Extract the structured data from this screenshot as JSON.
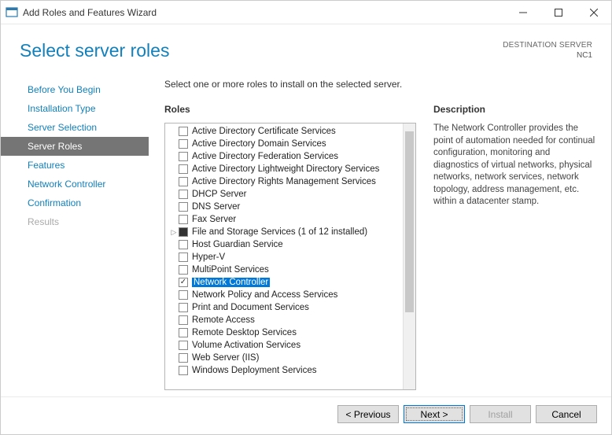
{
  "window": {
    "title": "Add Roles and Features Wizard"
  },
  "header": {
    "page_title": "Select server roles",
    "dest_label": "DESTINATION SERVER",
    "dest_server": "NC1"
  },
  "nav": {
    "items": [
      {
        "label": "Before You Begin",
        "state": "normal"
      },
      {
        "label": "Installation Type",
        "state": "normal"
      },
      {
        "label": "Server Selection",
        "state": "normal"
      },
      {
        "label": "Server Roles",
        "state": "active"
      },
      {
        "label": "Features",
        "state": "normal"
      },
      {
        "label": "Network Controller",
        "state": "normal"
      },
      {
        "label": "Confirmation",
        "state": "normal"
      },
      {
        "label": "Results",
        "state": "disabled"
      }
    ]
  },
  "main": {
    "instruction": "Select one or more roles to install on the selected server.",
    "roles_heading": "Roles",
    "desc_heading": "Description",
    "description": "The Network Controller provides the point of automation needed for continual configuration, monitoring and diagnostics of virtual networks, physical networks, network services, network topology, address management, etc. within a datacenter stamp.",
    "roles": [
      {
        "label": "Active Directory Certificate Services",
        "checked": false
      },
      {
        "label": "Active Directory Domain Services",
        "checked": false
      },
      {
        "label": "Active Directory Federation Services",
        "checked": false
      },
      {
        "label": "Active Directory Lightweight Directory Services",
        "checked": false
      },
      {
        "label": "Active Directory Rights Management Services",
        "checked": false
      },
      {
        "label": "DHCP Server",
        "checked": false
      },
      {
        "label": "DNS Server",
        "checked": false
      },
      {
        "label": "Fax Server",
        "checked": false
      },
      {
        "label": "File and Storage Services (1 of 12 installed)",
        "checked": false,
        "filled": true,
        "expandable": true
      },
      {
        "label": "Host Guardian Service",
        "checked": false
      },
      {
        "label": "Hyper-V",
        "checked": false
      },
      {
        "label": "MultiPoint Services",
        "checked": false
      },
      {
        "label": "Network Controller",
        "checked": true,
        "selected": true
      },
      {
        "label": "Network Policy and Access Services",
        "checked": false
      },
      {
        "label": "Print and Document Services",
        "checked": false
      },
      {
        "label": "Remote Access",
        "checked": false
      },
      {
        "label": "Remote Desktop Services",
        "checked": false
      },
      {
        "label": "Volume Activation Services",
        "checked": false
      },
      {
        "label": "Web Server (IIS)",
        "checked": false
      },
      {
        "label": "Windows Deployment Services",
        "checked": false
      }
    ]
  },
  "footer": {
    "previous": "< Previous",
    "next": "Next >",
    "install": "Install",
    "cancel": "Cancel"
  }
}
